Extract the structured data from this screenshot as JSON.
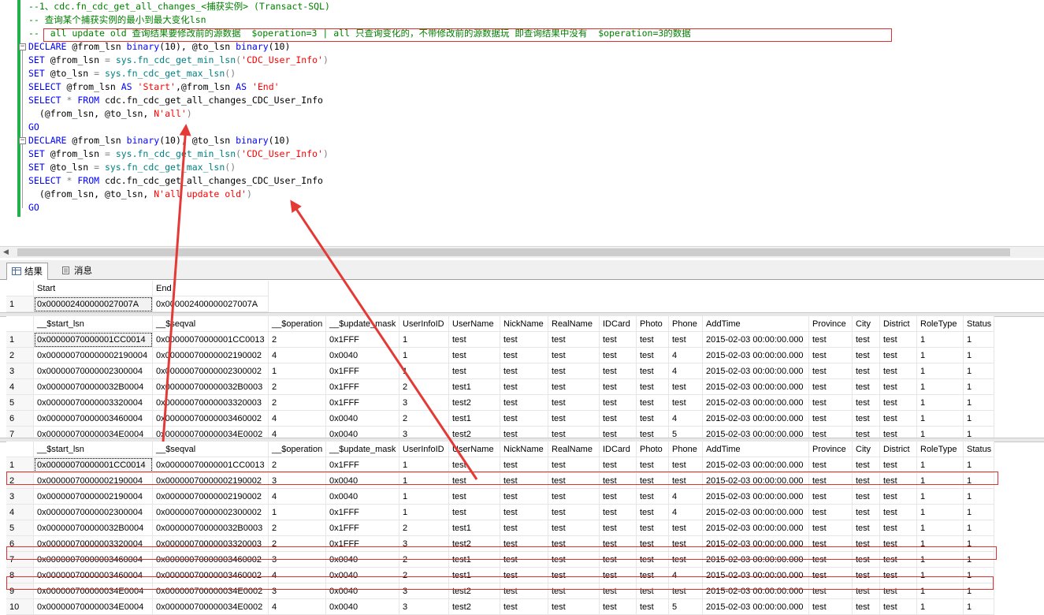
{
  "editor": {
    "lines": [
      [
        {
          "t": "--1、cdc.fn_cdc_get_all_changes_<捕获实例> (Transact-SQL)",
          "c": "cmt"
        }
      ],
      [
        {
          "t": "-- 查询某个捕获实例的最小到最大变化lsn",
          "c": "cmt"
        }
      ],
      [
        {
          "t": "--  all update old 查询结果要修改前的源数据  $operation=3 | all 只查询变化的，不带修改前的源数据玩 即查询结果中没有  $operation=3的数据",
          "c": "cmt"
        }
      ],
      [
        {
          "t": "DECLARE",
          "c": "kw"
        },
        {
          "t": " @from_lsn ",
          "c": ""
        },
        {
          "t": "binary",
          "c": "kw"
        },
        {
          "t": "(10), @to_lsn ",
          "c": ""
        },
        {
          "t": "binary",
          "c": "kw"
        },
        {
          "t": "(10)",
          "c": ""
        }
      ],
      [
        {
          "t": "SET",
          "c": "kw"
        },
        {
          "t": " @from_lsn ",
          "c": ""
        },
        {
          "t": "=",
          "c": "gry"
        },
        {
          "t": " sys.fn_cdc_get_min_lsn",
          "c": "sysfn"
        },
        {
          "t": "(",
          "c": "gry"
        },
        {
          "t": "'CDC_User_Info'",
          "c": "str"
        },
        {
          "t": ")",
          "c": "gry"
        }
      ],
      [
        {
          "t": "SET",
          "c": "kw"
        },
        {
          "t": " @to_lsn ",
          "c": ""
        },
        {
          "t": "=",
          "c": "gry"
        },
        {
          "t": " sys.fn_cdc_get_max_lsn",
          "c": "sysfn"
        },
        {
          "t": "()",
          "c": "gry"
        }
      ],
      [
        {
          "t": "SELECT",
          "c": "kw"
        },
        {
          "t": " @from_lsn ",
          "c": ""
        },
        {
          "t": "AS",
          "c": "kw"
        },
        {
          "t": " ",
          "c": ""
        },
        {
          "t": "'Start'",
          "c": "str"
        },
        {
          "t": ",@from_lsn ",
          "c": ""
        },
        {
          "t": "AS",
          "c": "kw"
        },
        {
          "t": " ",
          "c": ""
        },
        {
          "t": "'End'",
          "c": "str"
        }
      ],
      [
        {
          "t": "SELECT",
          "c": "kw"
        },
        {
          "t": " ",
          "c": ""
        },
        {
          "t": "*",
          "c": "gry"
        },
        {
          "t": " ",
          "c": ""
        },
        {
          "t": "FROM",
          "c": "kw"
        },
        {
          "t": " cdc.fn_cdc_get_all_changes_CDC_User_Info",
          "c": ""
        }
      ],
      [
        {
          "t": "  (@from_lsn, @to_lsn, ",
          "c": ""
        },
        {
          "t": "N'all'",
          "c": "str"
        },
        {
          "t": ")",
          "c": "gry"
        }
      ],
      [
        {
          "t": "GO",
          "c": "kw"
        }
      ],
      [
        {
          "t": "DECLARE",
          "c": "kw"
        },
        {
          "t": " @from_lsn ",
          "c": ""
        },
        {
          "t": "binary",
          "c": "kw"
        },
        {
          "t": "(10), @to_lsn ",
          "c": ""
        },
        {
          "t": "binary",
          "c": "kw"
        },
        {
          "t": "(10)",
          "c": ""
        }
      ],
      [
        {
          "t": "SET",
          "c": "kw"
        },
        {
          "t": " @from_lsn ",
          "c": ""
        },
        {
          "t": "=",
          "c": "gry"
        },
        {
          "t": " sys.fn_cdc_get_min_lsn",
          "c": "sysfn"
        },
        {
          "t": "(",
          "c": "gry"
        },
        {
          "t": "'CDC_User_Info'",
          "c": "str"
        },
        {
          "t": ")",
          "c": "gry"
        }
      ],
      [
        {
          "t": "SET",
          "c": "kw"
        },
        {
          "t": " @to_lsn ",
          "c": ""
        },
        {
          "t": "=",
          "c": "gry"
        },
        {
          "t": " sys.fn_cdc_get_max_lsn",
          "c": "sysfn"
        },
        {
          "t": "()",
          "c": "gry"
        }
      ],
      [
        {
          "t": "SELECT",
          "c": "kw"
        },
        {
          "t": " ",
          "c": ""
        },
        {
          "t": "*",
          "c": "gry"
        },
        {
          "t": " ",
          "c": ""
        },
        {
          "t": "FROM",
          "c": "kw"
        },
        {
          "t": " cdc.fn_cdc_get_all_changes_CDC_User_Info",
          "c": ""
        }
      ],
      [
        {
          "t": "  (@from_lsn, @to_lsn, ",
          "c": ""
        },
        {
          "t": "N'all update old'",
          "c": "str"
        },
        {
          "t": ")",
          "c": "gry"
        }
      ],
      [
        {
          "t": "GO",
          "c": "kw"
        }
      ]
    ]
  },
  "tabs": {
    "results": "结果",
    "messages": "消息"
  },
  "grid1": {
    "columns": [
      "Start",
      "End"
    ],
    "rows": [
      [
        "1",
        "0x000002400000027007A",
        "0x000002400000027007A"
      ]
    ]
  },
  "grid2": {
    "columns": [
      "__$start_lsn",
      "__$seqval",
      "__$operation",
      "__$update_mask",
      "UserInfoID",
      "UserName",
      "NickName",
      "RealName",
      "IDCard",
      "Photo",
      "Phone",
      "AddTime",
      "Province",
      "City",
      "District",
      "RoleType",
      "Status"
    ],
    "rows": [
      [
        "1",
        "0x00000070000001CC0014",
        "0x00000070000001CC0013",
        "2",
        "0x1FFF",
        "1",
        "test",
        "test",
        "test",
        "test",
        "test",
        "test",
        "2015-02-03 00:00:00.000",
        "test",
        "test",
        "test",
        "1",
        "1"
      ],
      [
        "2",
        "0x000000700000002190004",
        "0x00000070000002190002",
        "4",
        "0x0040",
        "1",
        "test",
        "test",
        "test",
        "test",
        "test",
        "4",
        "2015-02-03 00:00:00.000",
        "test",
        "test",
        "test",
        "1",
        "1"
      ],
      [
        "3",
        "0x00000070000002300004",
        "0x00000070000002300002",
        "1",
        "0x1FFF",
        "1",
        "test",
        "test",
        "test",
        "test",
        "test",
        "4",
        "2015-02-03 00:00:00.000",
        "test",
        "test",
        "test",
        "1",
        "1"
      ],
      [
        "4",
        "0x000000700000032B0004",
        "0x000000700000032B0003",
        "2",
        "0x1FFF",
        "2",
        "test1",
        "test",
        "test",
        "test",
        "test",
        "test",
        "2015-02-03 00:00:00.000",
        "test",
        "test",
        "test",
        "1",
        "1"
      ],
      [
        "5",
        "0x00000070000003320004",
        "0x00000070000003320003",
        "2",
        "0x1FFF",
        "3",
        "test2",
        "test",
        "test",
        "test",
        "test",
        "test",
        "2015-02-03 00:00:00.000",
        "test",
        "test",
        "test",
        "1",
        "1"
      ],
      [
        "6",
        "0x00000070000003460004",
        "0x00000070000003460002",
        "4",
        "0x0040",
        "2",
        "test1",
        "test",
        "test",
        "test",
        "test",
        "4",
        "2015-02-03 00:00:00.000",
        "test",
        "test",
        "test",
        "1",
        "1"
      ],
      [
        "7",
        "0x000000700000034E0004",
        "0x000000700000034E0002",
        "4",
        "0x0040",
        "3",
        "test2",
        "test",
        "test",
        "test",
        "test",
        "5",
        "2015-02-03 00:00:00.000",
        "test",
        "test",
        "test",
        "1",
        "1"
      ]
    ]
  },
  "grid3": {
    "columns": [
      "__$start_lsn",
      "__$seqval",
      "__$operation",
      "__$update_mask",
      "UserInfoID",
      "UserName",
      "NickName",
      "RealName",
      "IDCard",
      "Photo",
      "Phone",
      "AddTime",
      "Province",
      "City",
      "District",
      "RoleType",
      "Status"
    ],
    "rows": [
      [
        "1",
        "0x00000070000001CC0014",
        "0x00000070000001CC0013",
        "2",
        "0x1FFF",
        "1",
        "test",
        "test",
        "test",
        "test",
        "test",
        "test",
        "2015-02-03 00:00:00.000",
        "test",
        "test",
        "test",
        "1",
        "1"
      ],
      [
        "2",
        "0x00000070000002190004",
        "0x00000070000002190002",
        "3",
        "0x0040",
        "1",
        "test",
        "test",
        "test",
        "test",
        "test",
        "test",
        "2015-02-03 00:00:00.000",
        "test",
        "test",
        "test",
        "1",
        "1"
      ],
      [
        "3",
        "0x00000070000002190004",
        "0x00000070000002190002",
        "4",
        "0x0040",
        "1",
        "test",
        "test",
        "test",
        "test",
        "test",
        "4",
        "2015-02-03 00:00:00.000",
        "test",
        "test",
        "test",
        "1",
        "1"
      ],
      [
        "4",
        "0x00000070000002300004",
        "0x00000070000002300002",
        "1",
        "0x1FFF",
        "1",
        "test",
        "test",
        "test",
        "test",
        "test",
        "4",
        "2015-02-03 00:00:00.000",
        "test",
        "test",
        "test",
        "1",
        "1"
      ],
      [
        "5",
        "0x000000700000032B0004",
        "0x000000700000032B0003",
        "2",
        "0x1FFF",
        "2",
        "test1",
        "test",
        "test",
        "test",
        "test",
        "test",
        "2015-02-03 00:00:00.000",
        "test",
        "test",
        "test",
        "1",
        "1"
      ],
      [
        "6",
        "0x00000070000003320004",
        "0x00000070000003320003",
        "2",
        "0x1FFF",
        "3",
        "test2",
        "test",
        "test",
        "test",
        "test",
        "test",
        "2015-02-03 00:00:00.000",
        "test",
        "test",
        "test",
        "1",
        "1"
      ],
      [
        "7",
        "0x00000070000003460004",
        "0x00000070000003460002",
        "3",
        "0x0040",
        "2",
        "test1",
        "test",
        "test",
        "test",
        "test",
        "test",
        "2015-02-03 00:00:00.000",
        "test",
        "test",
        "test",
        "1",
        "1"
      ],
      [
        "8",
        "0x00000070000003460004",
        "0x00000070000003460002",
        "4",
        "0x0040",
        "2",
        "test1",
        "test",
        "test",
        "test",
        "test",
        "4",
        "2015-02-03 00:00:00.000",
        "test",
        "test",
        "test",
        "1",
        "1"
      ],
      [
        "9",
        "0x000000700000034E0004",
        "0x000000700000034E0002",
        "3",
        "0x0040",
        "3",
        "test2",
        "test",
        "test",
        "test",
        "test",
        "test",
        "2015-02-03 00:00:00.000",
        "test",
        "test",
        "test",
        "1",
        "1"
      ],
      [
        "10",
        "0x000000700000034E0004",
        "0x000000700000034E0002",
        "4",
        "0x0040",
        "3",
        "test2",
        "test",
        "test",
        "test",
        "test",
        "5",
        "2015-02-03 00:00:00.000",
        "test",
        "test",
        "test",
        "1",
        "1"
      ]
    ]
  },
  "colors": {
    "annotation": "#e03030",
    "keyword": "#0000ff",
    "string": "#ff0000",
    "comment": "#008000"
  }
}
